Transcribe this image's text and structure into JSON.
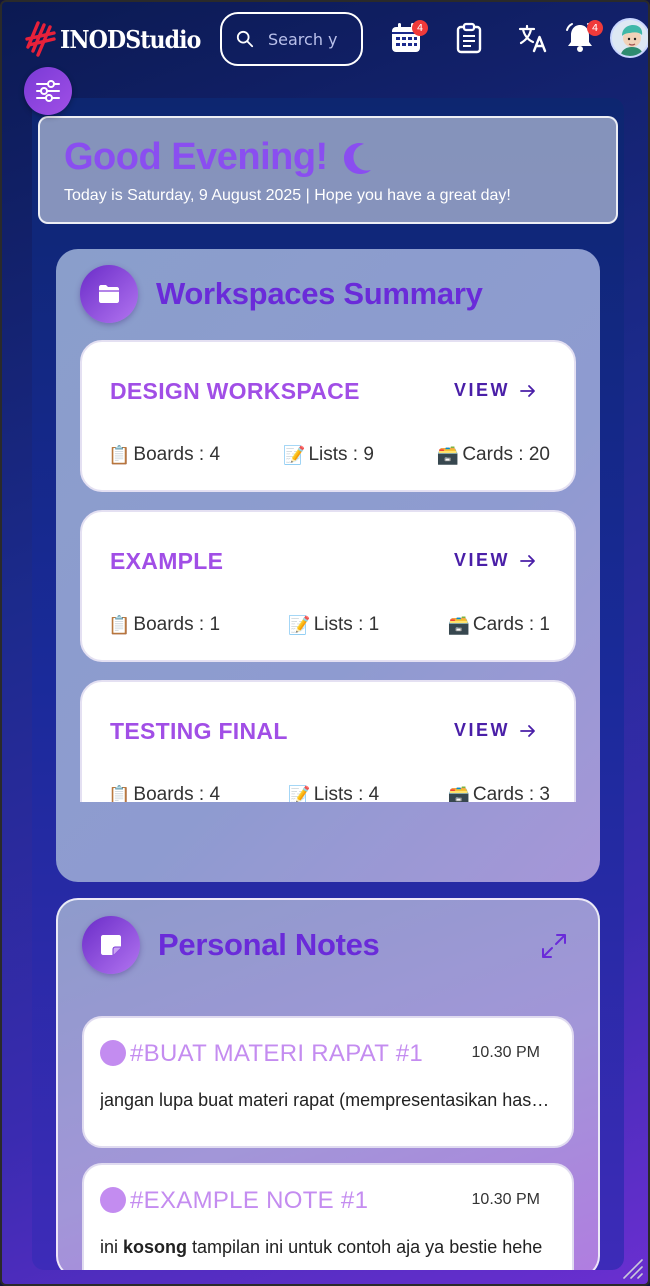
{
  "header": {
    "brand": "INODStudio",
    "search_placeholder": "Search your workspace",
    "calendar_badge": "4",
    "notification_badge": "4"
  },
  "greeting": {
    "title": "Good Evening!",
    "subtitle": "Today is Saturday, 9 August 2025 | Hope you have a great day!"
  },
  "workspaces": {
    "title": "Workspaces Summary",
    "view_label": "VIEW",
    "items": [
      {
        "name": "DESIGN WORKSPACE",
        "boards": "Boards : 4",
        "lists": "Lists : 9",
        "cards": "Cards : 20"
      },
      {
        "name": "EXAMPLE",
        "boards": "Boards : 1",
        "lists": "Lists : 1",
        "cards": "Cards : 1"
      },
      {
        "name": "TESTING FINAL",
        "boards": "Boards : 4",
        "lists": "Lists : 4",
        "cards": "Cards : 3"
      }
    ]
  },
  "notes": {
    "title": "Personal Notes",
    "items": [
      {
        "title": "#BUAT MATERI RAPAT #1",
        "time": "10.30 PM",
        "body": "jangan lupa buat materi rapat (mempresentasikan hasil kerja minggu ini)"
      },
      {
        "title": "#EXAMPLE NOTE #1",
        "time": "10.30 PM",
        "body_prefix": "ini ",
        "body_bold": "kosong",
        "body_suffix": " tampilan ini untuk contoh aja ya bestie hehe"
      }
    ]
  },
  "colors": {
    "accent": "#8a4ef0",
    "title_purple": "#6a2bd9",
    "badge_red": "#f03a3a"
  }
}
